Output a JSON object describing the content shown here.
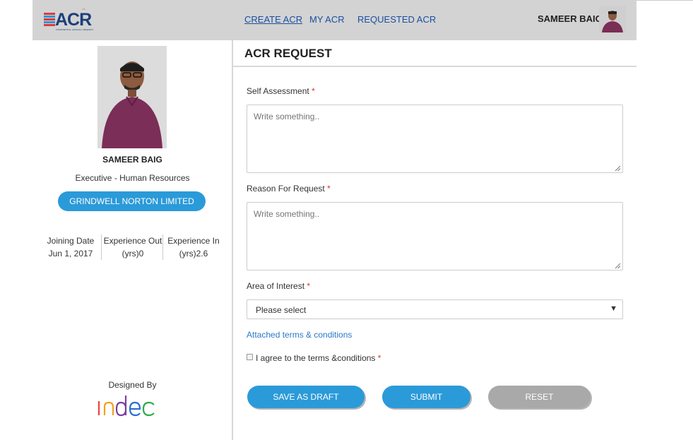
{
  "header": {
    "logo_text": "ACR",
    "logo_tagline": "CONFIDENTIAL | ANNUAL | REQUEST",
    "nav": [
      {
        "label": "CREATE ACR",
        "active": true
      },
      {
        "label": "MY ACR",
        "active": false
      },
      {
        "label": "REQUESTED ACR",
        "active": false
      }
    ],
    "user_name": "SAMEER BAIG"
  },
  "profile": {
    "name": "SAMEER BAIG",
    "designation": "Executive - Human Resources",
    "company": "GRINDWELL NORTON LIMITED",
    "stats": [
      {
        "label": "Joining Date",
        "value": "Jun 1, 2017"
      },
      {
        "label": "Experience Out",
        "value": "(yrs)0"
      },
      {
        "label": "Experience In",
        "value": "(yrs)2.6"
      }
    ],
    "designed_by": "Designed By",
    "designer_logo": "indec"
  },
  "form": {
    "title": "ACR REQUEST",
    "self_assessment": {
      "label": "Self Assessment",
      "placeholder": "Write something.."
    },
    "reason": {
      "label": "Reason For Request",
      "placeholder": "Write something.."
    },
    "area_of_interest": {
      "label": "Area of Interest",
      "selected": "Please select"
    },
    "terms_link": "Attached terms & conditions",
    "agree_label": "I agree to the terms &conditions",
    "required_mark": "*",
    "buttons": {
      "save_draft": "SAVE AS DRAFT",
      "submit": "SUBMIT",
      "reset": "RESET"
    }
  },
  "colors": {
    "accent": "#2b9ad9",
    "nav_link": "#1a4fa0",
    "header_bg": "#d3d3d3",
    "required": "#e03030",
    "reset_bg": "#a9a9a9"
  },
  "icons": {
    "dropdown": "caret-down-icon",
    "resize": "resize-grip-icon"
  }
}
